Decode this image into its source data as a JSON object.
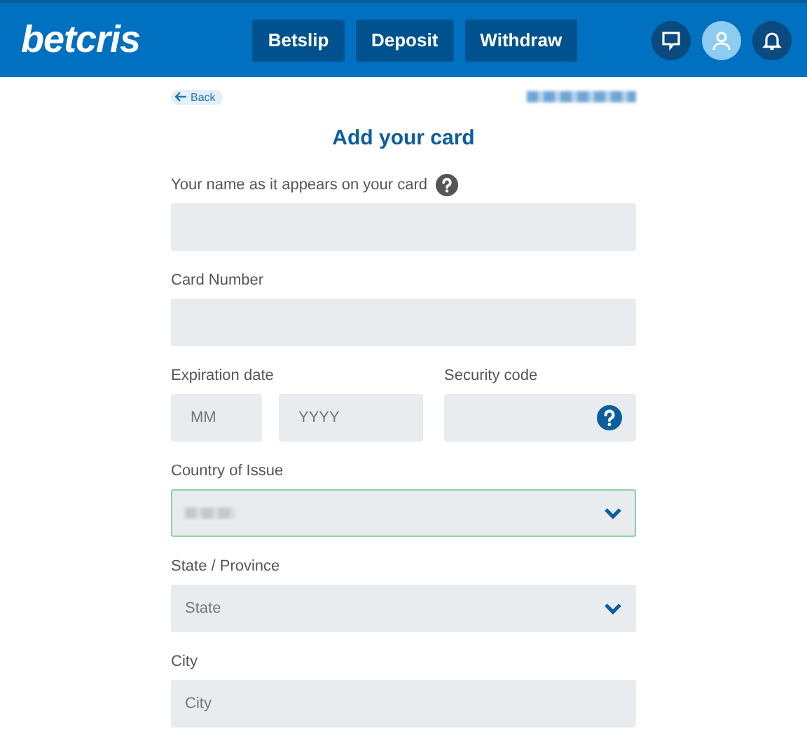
{
  "header": {
    "logo": "betcris",
    "buttons": [
      "Betslip",
      "Deposit",
      "Withdraw"
    ],
    "icons": [
      {
        "kind": "chat",
        "selected": false
      },
      {
        "kind": "user",
        "selected": true
      },
      {
        "kind": "bell",
        "selected": false
      }
    ]
  },
  "back": {
    "label": "Back"
  },
  "title": "Add your card",
  "fields": [
    {
      "kind": "text",
      "label": "Your name as it appears on your card",
      "help": true
    },
    {
      "kind": "text",
      "label": "Card Number",
      "help": false
    },
    {
      "kind": "split",
      "label": "Expiration date",
      "parts": [
        {
          "placeholder": "MM"
        },
        {
          "placeholder": "YYYY"
        }
      ],
      "side": {
        "label": "Security code",
        "help": true
      }
    },
    {
      "kind": "select",
      "label": "Country of Issue",
      "focused": true,
      "redacted": true
    },
    {
      "kind": "select",
      "label": "State / Province",
      "focused": false,
      "placeholder": "State"
    },
    {
      "kind": "text",
      "label": "City",
      "help": false,
      "placeholder": "City"
    }
  ]
}
